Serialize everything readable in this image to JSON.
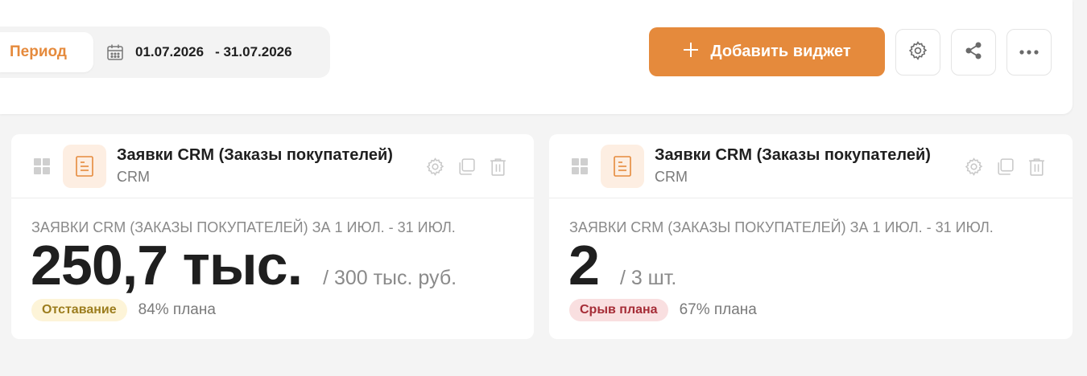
{
  "toolbar": {
    "period_label": "Период",
    "date_from": "01.07.2026",
    "date_to": "- 31.07.2026",
    "add_widget_label": "Добавить виджет"
  },
  "icons": {
    "calendar": "calendar-icon",
    "plus": "plus-icon",
    "settings": "gear-icon",
    "share": "share-icon",
    "more": "more-horizontal-icon"
  },
  "colors": {
    "accent": "#e58a3c",
    "warn_badge_bg": "#fdf4d8",
    "warn_badge_text": "#9c7d1e",
    "bad_badge_bg": "#f9dfe0",
    "bad_badge_text": "#a52c36"
  },
  "widgets": [
    {
      "title": "Заявки CRM (Заказы покупателей)",
      "source": "CRM",
      "caption": "ЗАЯВКИ CRM (ЗАКАЗЫ ПОКУПАТЕЛЕЙ) ЗА 1 ИЮЛ. - 31 ИЮЛ.",
      "value": "250,7 тыс.",
      "plan": "/ 300 тыс. руб.",
      "status": "Отставание",
      "percent": "84% плана"
    },
    {
      "title": "Заявки CRM (Заказы покупателей)",
      "source": "CRM",
      "caption": "ЗАЯВКИ CRM (ЗАКАЗЫ ПОКУПАТЕЛЕЙ) ЗА 1 ИЮЛ. - 31 ИЮЛ.",
      "value": "2",
      "plan": "/ 3 шт.",
      "status": "Срыв плана",
      "percent": "67% плана"
    }
  ]
}
